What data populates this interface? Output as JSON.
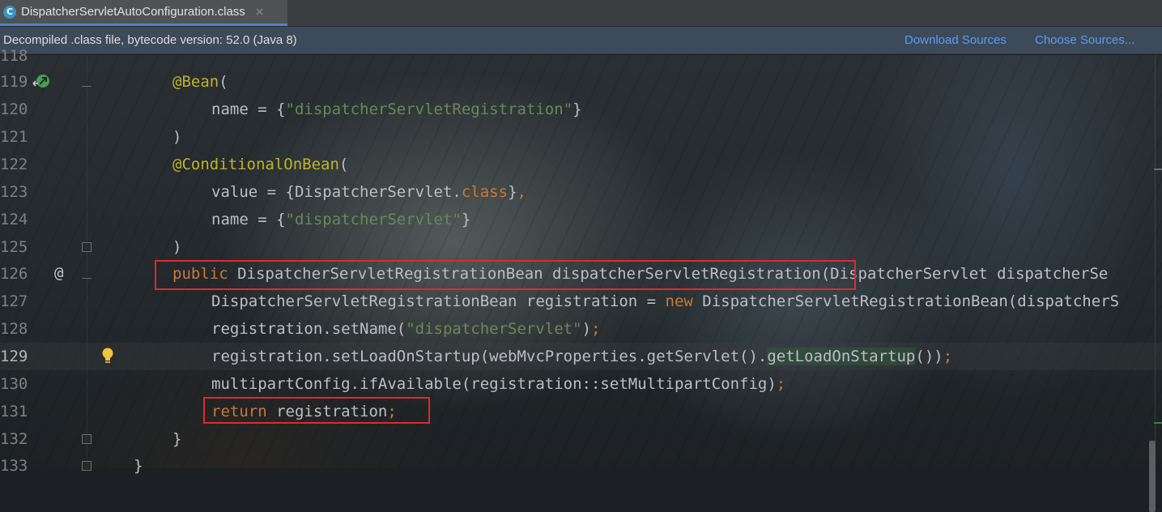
{
  "tab": {
    "icon": "class-file-icon",
    "label": "DispatcherServletAutoConfiguration.class",
    "close": "×"
  },
  "banner": {
    "text": "Decompiled .class file, bytecode version: 52.0 (Java 8)",
    "download_sources": "Download Sources",
    "choose_sources": "Choose Sources..."
  },
  "colors": {
    "keyword": "#cc7832",
    "string": "#6a8759",
    "annotation": "#bbb529",
    "text": "#bcbec4",
    "highlight_box": "#e02a2a",
    "link": "#589df6"
  },
  "editor": {
    "current_line": "129",
    "lines": [
      {
        "num": "118",
        "text": ""
      },
      {
        "num": "119",
        "text": "@Bean("
      },
      {
        "num": "120",
        "text": "name = {\"dispatcherServletRegistration\"}"
      },
      {
        "num": "121",
        "text": ")"
      },
      {
        "num": "122",
        "text": "@ConditionalOnBean("
      },
      {
        "num": "123",
        "text": "value = {DispatcherServlet.class},"
      },
      {
        "num": "124",
        "text": "name = {\"dispatcherServlet\"}"
      },
      {
        "num": "125",
        "text": ")"
      },
      {
        "num": "126",
        "text": "public DispatcherServletRegistrationBean dispatcherServletRegistration(DispatcherServlet dispatcherSe"
      },
      {
        "num": "127",
        "text": "DispatcherServletRegistrationBean registration = new DispatcherServletRegistrationBean(dispatcherS"
      },
      {
        "num": "128",
        "text": "registration.setName(\"dispatcherServlet\");"
      },
      {
        "num": "129",
        "text": "registration.setLoadOnStartup(webMvcProperties.getServlet().getLoadOnStartup());"
      },
      {
        "num": "130",
        "text": "multipartConfig.ifAvailable(registration::setMultipartConfig);"
      },
      {
        "num": "131",
        "text": "return registration;"
      },
      {
        "num": "132",
        "text": "}"
      },
      {
        "num": "133",
        "text": "}"
      }
    ]
  },
  "gutter_icons": {
    "line_119": "bean-navigate-icon",
    "line_126": "override-at-icon",
    "line_129": "lightbulb-icon"
  }
}
